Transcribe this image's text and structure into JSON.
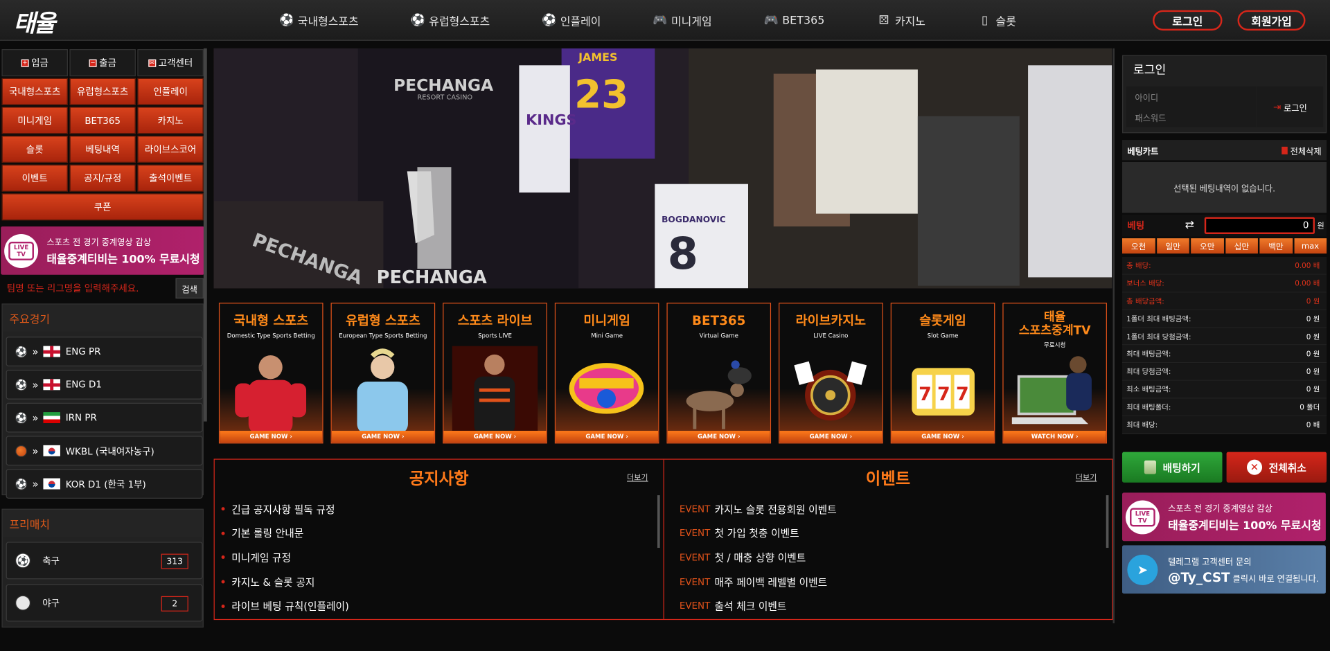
{
  "header": {
    "logo": "태율",
    "nav": [
      {
        "label": "국내형스포츠",
        "icon": "soccer-ball-icon"
      },
      {
        "label": "유럽형스포츠",
        "icon": "soccer-ball-icon"
      },
      {
        "label": "인플레이",
        "icon": "soccer-ball-icon"
      },
      {
        "label": "미니게임",
        "icon": "gamepad-icon"
      },
      {
        "label": "BET365",
        "icon": "gamepad-icon"
      },
      {
        "label": "카지노",
        "icon": "dice-icon"
      },
      {
        "label": "슬롯",
        "icon": "slot-machine-icon"
      }
    ],
    "login_label": "로그인",
    "join_label": "회원가입"
  },
  "left": {
    "quick": [
      {
        "label": "입금"
      },
      {
        "label": "출금"
      },
      {
        "label": "고객센터"
      }
    ],
    "menu": [
      "국내형스포츠",
      "유럽형스포츠",
      "인플레이",
      "미니게임",
      "BET365",
      "카지노",
      "슬롯",
      "베팅내역",
      "라이브스코어",
      "이벤트",
      "공지/규정",
      "출석이벤트"
    ],
    "coupon": "쿠폰",
    "livetv": {
      "line1": "스포츠 전 경기 중계영상 감상",
      "line2": "태율중계티비는 100% 무료시청",
      "badge": "LIVE TV"
    },
    "search": {
      "placeholder": "팀명 또는 리그명을 입력해주세요.",
      "button": "검색"
    },
    "main_title": "주요경기",
    "leagues": [
      {
        "name": "ENG PR",
        "flag": "eng",
        "sport": "soccer"
      },
      {
        "name": "ENG D1",
        "flag": "eng",
        "sport": "soccer"
      },
      {
        "name": "IRN PR",
        "flag": "irn",
        "sport": "soccer"
      },
      {
        "name": "WKBL (국내여자농구)",
        "flag": "kor",
        "sport": "basketball"
      },
      {
        "name": "KOR D1 (한국 1부)",
        "flag": "kor",
        "sport": "soccer"
      }
    ],
    "prematch_title": "프리매치",
    "prematch": [
      {
        "name": "축구",
        "count": "313",
        "sport": "soccer"
      },
      {
        "name": "야구",
        "count": "2",
        "sport": "baseball"
      }
    ]
  },
  "cards": [
    {
      "title": "국내형 스포츠",
      "sub": "Domestic Type Sports Betting",
      "cta": "GAME NOW ›"
    },
    {
      "title": "유럽형 스포츠",
      "sub": "European Type Sports Betting",
      "cta": "GAME NOW ›"
    },
    {
      "title": "스포츠 라이브",
      "sub": "Sports LIVE",
      "cta": "GAME NOW ›"
    },
    {
      "title": "미니게임",
      "sub": "Mini Game",
      "cta": "GAME NOW ›"
    },
    {
      "title": "BET365",
      "sub": "Virtual Game",
      "cta": "GAME NOW ›"
    },
    {
      "title": "라이브카지노",
      "sub": "LIVE Casino",
      "cta": "GAME NOW ›"
    },
    {
      "title": "슬롯게임",
      "sub": "Slot Game",
      "cta": "GAME NOW ›"
    },
    {
      "title": "태율\n스포츠중계TV",
      "sub": "무료시청",
      "cta": "WATCH NOW ›"
    }
  ],
  "video": {
    "overlay_texts": [
      "PECHANGA",
      "RESORT CASINO",
      "JAMES",
      "23",
      "KINGS",
      "BOGDANOVIC",
      "8",
      "PECHANGA",
      "PECHANGA"
    ]
  },
  "notice": {
    "title": "공지사항",
    "more": "더보기",
    "items": [
      "긴급 공지사항 필독 규정",
      "기본 롤링 안내문",
      "미니게임 규정",
      "카지노 & 슬롯 공지",
      "라이브 베팅 규칙(인플레이)"
    ]
  },
  "events": {
    "title": "이벤트",
    "more": "더보기",
    "tag": "EVENT",
    "items": [
      "카지노 슬롯 전용회원 이벤트",
      "첫 가입 첫충 이벤트",
      "첫 / 매충 상향 이벤트",
      "매주 페이백 레벨별 이벤트",
      "출석 체크 이벤트"
    ]
  },
  "right": {
    "login_title": "로그인",
    "id_placeholder": "아이디",
    "pw_placeholder": "패스워드",
    "login_button": "로그인",
    "cart_title": "베팅카트",
    "cart_clear": "전체삭제",
    "cart_empty": "선택된 베팅내역이 없습니다.",
    "bet_label": "베팅",
    "bet_amount": "0",
    "won": "원",
    "chips": [
      "오천",
      "일만",
      "오만",
      "십만",
      "백만",
      "max"
    ],
    "stats": [
      {
        "k": "총 배당:",
        "v": "0.00 배",
        "red": true
      },
      {
        "k": "보너스 배당:",
        "v": "0.00 배",
        "red": true
      },
      {
        "k": "총 배당금액:",
        "v": "0 원",
        "red": true
      },
      {
        "k": "1폴더 최대 배팅금액:",
        "v": "0 원",
        "red": false
      },
      {
        "k": "1폴더 최대 당첨금액:",
        "v": "0 원",
        "red": false
      },
      {
        "k": "최대 배팅금액:",
        "v": "0 원",
        "red": false
      },
      {
        "k": "최대 당첨금액:",
        "v": "0 원",
        "red": false
      },
      {
        "k": "최소 배팅금액:",
        "v": "0 원",
        "red": false
      },
      {
        "k": "최대 배팅폴더:",
        "v": "0 폴더",
        "red": false
      },
      {
        "k": "최대 배당:",
        "v": "0 배",
        "red": false
      }
    ],
    "bet_button": "배팅하기",
    "cancel_button": "전체취소",
    "livetv": {
      "line1": "스포츠 전 경기 중계영상 감상",
      "line2": "태율중계티비는 100% 무료시청",
      "badge": "LIVE TV"
    },
    "telegram": {
      "line1": "텔레그램 고객센터 문의",
      "handle": "@Ty_CST",
      "line2": "클릭시 바로 연결됩니다."
    }
  }
}
